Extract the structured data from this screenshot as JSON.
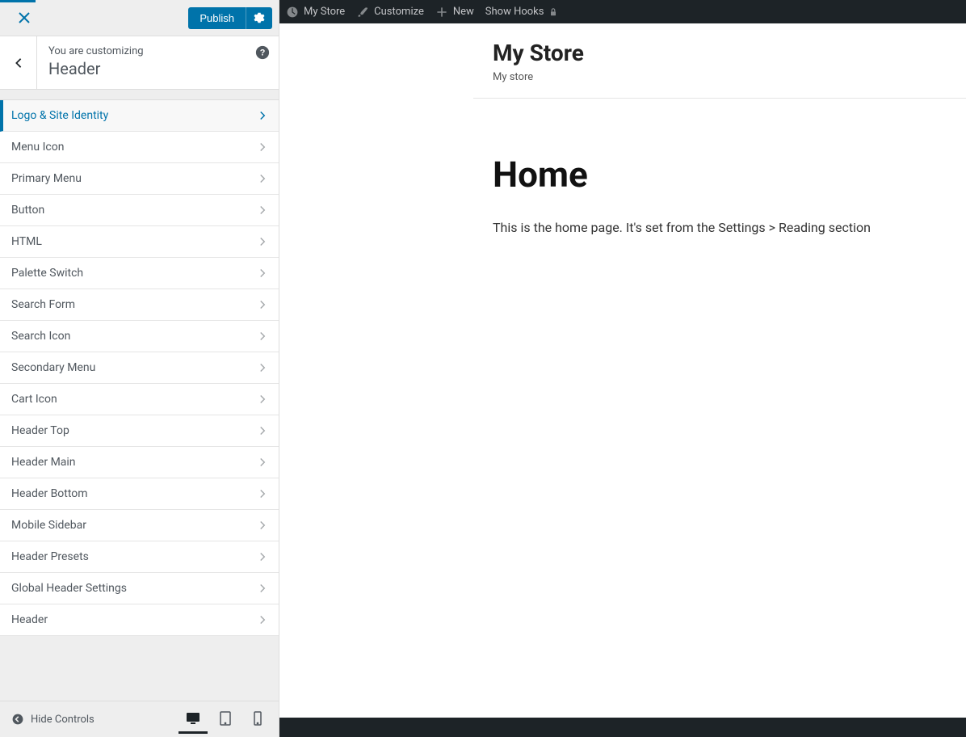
{
  "sidebar": {
    "publish_label": "Publish",
    "customizing_label": "You are customizing",
    "section_name": "Header",
    "hide_controls_label": "Hide Controls",
    "items": [
      {
        "label": "Logo & Site Identity",
        "active": true
      },
      {
        "label": "Menu Icon"
      },
      {
        "label": "Primary Menu"
      },
      {
        "label": "Button"
      },
      {
        "label": "HTML"
      },
      {
        "label": "Palette Switch"
      },
      {
        "label": "Search Form"
      },
      {
        "label": "Search Icon"
      },
      {
        "label": "Secondary Menu"
      },
      {
        "label": "Cart Icon"
      },
      {
        "label": "Header Top"
      },
      {
        "label": "Header Main"
      },
      {
        "label": "Header Bottom"
      },
      {
        "label": "Mobile Sidebar"
      },
      {
        "label": "Header Presets"
      },
      {
        "label": "Global Header Settings"
      },
      {
        "label": "Header"
      }
    ]
  },
  "adminbar": {
    "site_name": "My Store",
    "customize": "Customize",
    "new": "New",
    "show_hooks": "Show Hooks"
  },
  "preview": {
    "site_title": "My Store",
    "site_tagline": "My store",
    "page_title": "Home",
    "page_desc": "This is the home page. It's set from the Settings > Reading section"
  }
}
